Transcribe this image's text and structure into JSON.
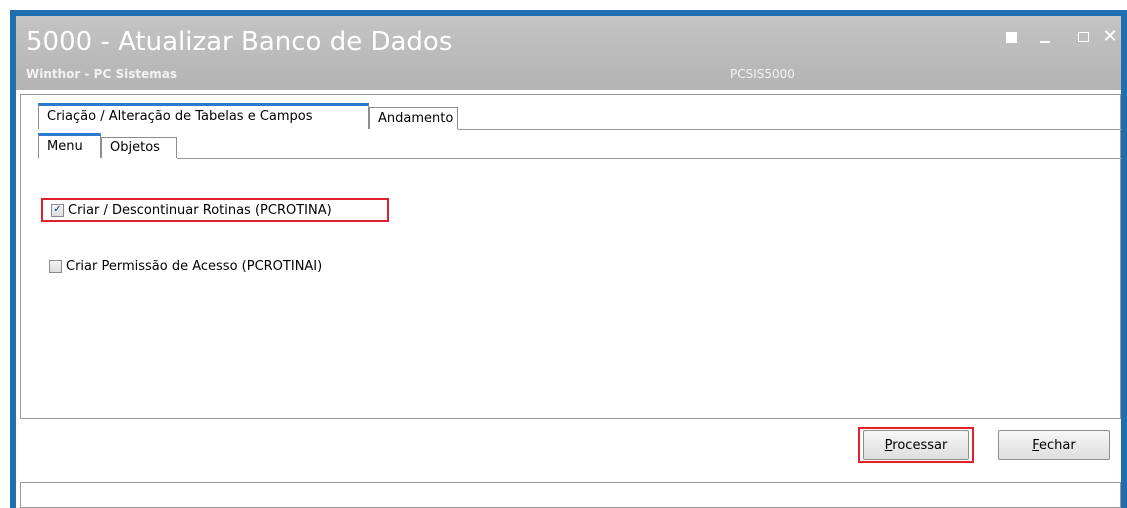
{
  "window": {
    "title": "5000 - Atualizar Banco de Dados",
    "subtitle": "Winthor - PC Sistemas",
    "code": "PCSIS5000",
    "controls": [
      "restore-icon",
      "minimize-icon",
      "maximize-icon",
      "close-icon"
    ],
    "close_glyph": "✕"
  },
  "tabs": {
    "main": [
      {
        "label": "Criação / Alteração de Tabelas e Campos",
        "active": true
      },
      {
        "label": "Andamento",
        "active": false
      }
    ],
    "sub": [
      {
        "label": "Menu",
        "active": true
      },
      {
        "label": "Objetos",
        "active": false
      }
    ]
  },
  "options": [
    {
      "label": "Criar / Descontinuar Rotinas (PCROTINA)",
      "checked": true,
      "check_glyph": "✓"
    },
    {
      "label": "Criar Permissão de Acesso (PCROTINAI)",
      "checked": false,
      "check_glyph": ""
    }
  ],
  "buttons": {
    "processar": {
      "mnemonic": "P",
      "rest": "rocessar"
    },
    "fechar": {
      "mnemonic": "F",
      "rest": "echar"
    }
  },
  "colors": {
    "frame": "#1f6fb0",
    "titlebar": "#bdbdbd",
    "highlight": "#e0202a",
    "active_tab": "#2a7ad0"
  }
}
